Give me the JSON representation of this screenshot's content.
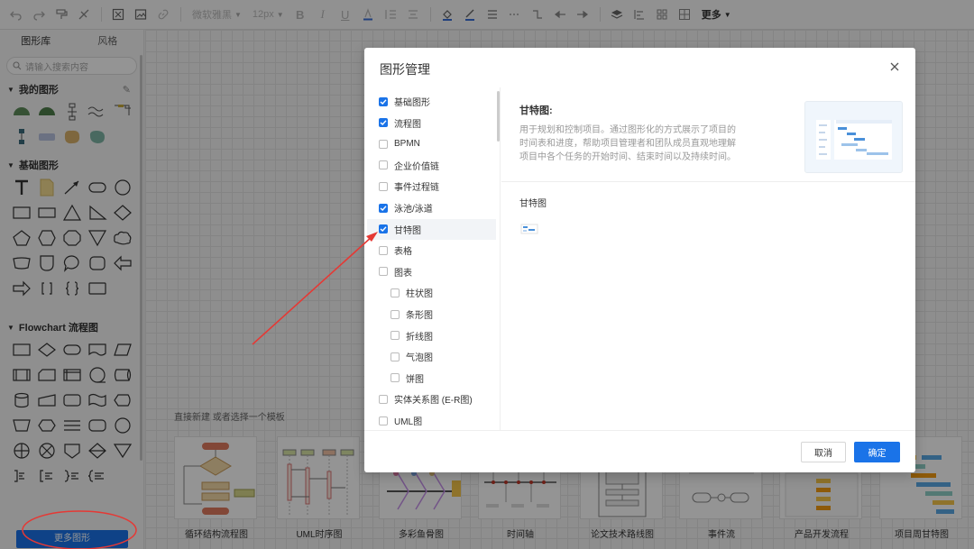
{
  "toolbar": {
    "font_name": "微软雅黑",
    "font_size": "12px",
    "more_label": "更多"
  },
  "sidebar": {
    "tabs": [
      "图形库",
      "风格"
    ],
    "search_placeholder": "请输入搜索内容",
    "sections": {
      "my_shapes": "我的图形",
      "basic_shapes": "基础图形",
      "flowchart": "Flowchart 流程图"
    },
    "more_shapes_button": "更多图形"
  },
  "canvas": {
    "hint": "直接新建 或者选择一个模板",
    "templates": [
      "循环结构流程图",
      "UML时序图",
      "多彩鱼骨图",
      "时间轴",
      "论文技术路线图",
      "事件流",
      "产品开发流程",
      "项目周甘特图"
    ]
  },
  "dialog": {
    "title": "图形管理",
    "categories": [
      {
        "label": "基础图形",
        "checked": true,
        "indent": false
      },
      {
        "label": "流程图",
        "checked": true,
        "indent": false
      },
      {
        "label": "BPMN",
        "checked": false,
        "indent": false
      },
      {
        "label": "企业价值链",
        "checked": false,
        "indent": false
      },
      {
        "label": "事件过程链",
        "checked": false,
        "indent": false
      },
      {
        "label": "泳池/泳道",
        "checked": true,
        "indent": false
      },
      {
        "label": "甘特图",
        "checked": true,
        "indent": false,
        "selected": true
      },
      {
        "label": "表格",
        "checked": false,
        "indent": false
      },
      {
        "label": "图表",
        "checked": false,
        "indent": false
      },
      {
        "label": "柱状图",
        "checked": false,
        "indent": true
      },
      {
        "label": "条形图",
        "checked": false,
        "indent": true
      },
      {
        "label": "折线图",
        "checked": false,
        "indent": true
      },
      {
        "label": "气泡图",
        "checked": false,
        "indent": true
      },
      {
        "label": "饼图",
        "checked": false,
        "indent": true
      },
      {
        "label": "实体关系图 (E-R图)",
        "checked": false,
        "indent": false
      },
      {
        "label": "UML图",
        "checked": false,
        "indent": false
      }
    ],
    "info_title": "甘特图:",
    "info_desc": "用于规划和控制项目。通过图形化的方式展示了项目的时间表和进度，帮助项目管理者和团队成员直观地理解项目中各个任务的开始时间、结束时间以及持续时间。",
    "group_title": "甘特图",
    "cancel_label": "取消",
    "ok_label": "确定"
  },
  "colors": {
    "accent": "#1a73e8",
    "annotation": "#e53935"
  }
}
